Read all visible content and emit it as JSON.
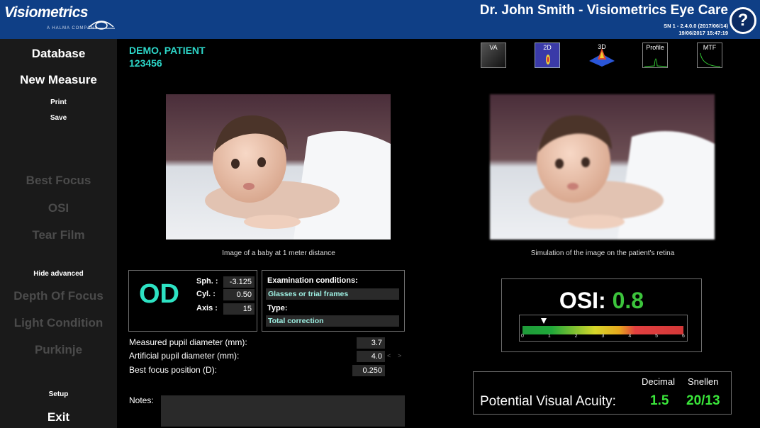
{
  "header": {
    "logo_text": "Visiometrics",
    "logo_sub": "A HALMA COMPANY",
    "title": "Dr. John Smith - Visiometrics Eye Care",
    "serial": "SN 1 - 2.4.0.0 (2017/06/14)",
    "datetime": "19/06/2017 15:47:19",
    "help_label": "?"
  },
  "sidebar": {
    "database": "Database",
    "new_measure": "New Measure",
    "print": "Print",
    "save": "Save",
    "best_focus": "Best Focus",
    "osi": "OSI",
    "tear_film": "Tear Film",
    "hide_advanced": "Hide advanced",
    "depth_of_focus": "Depth Of Focus",
    "light_condition": "Light Condition",
    "purkinje": "Purkinje",
    "setup": "Setup",
    "exit": "Exit"
  },
  "patient": {
    "name": "DEMO, PATIENT",
    "id": "123456"
  },
  "toolbar": {
    "va": "VA",
    "two_d": "2D",
    "three_d": "3D",
    "profile": "Profile",
    "mtf": "MTF"
  },
  "captions": {
    "left": "Image of a baby at 1 meter distance",
    "right": "Simulation of the image on the patient's retina"
  },
  "refraction": {
    "eye": "OD",
    "sph_label": "Sph. :",
    "sph": "-3.125",
    "cyl_label": "Cyl. :",
    "cyl": "0.50",
    "axis_label": "Axis :",
    "axis": "15"
  },
  "exam": {
    "conditions_label": "Examination conditions:",
    "conditions": "Glasses or trial frames",
    "type_label": "Type:",
    "type": "Total correction"
  },
  "measurements": {
    "pupil_label": "Measured pupil diameter (mm):",
    "pupil": "3.7",
    "artificial_label": "Artificial pupil diameter (mm):",
    "artificial": "4.0",
    "focus_label": "Best focus position (D):",
    "focus": "0.250",
    "dec_arrow": "<",
    "inc_arrow": ">"
  },
  "notes": {
    "label": "Notes:",
    "value": ""
  },
  "osi": {
    "label": "OSI:",
    "value": "0.8",
    "value_num": 0.8,
    "scale_min": 0,
    "scale_max": 6,
    "ticks": [
      "0",
      "1",
      "2",
      "3",
      "4",
      "5",
      "6"
    ]
  },
  "visual_acuity": {
    "label": "Potential Visual Acuity:",
    "decimal_header": "Decimal",
    "snellen_header": "Snellen",
    "decimal": "1.5",
    "snellen": "20/13"
  },
  "colors": {
    "header_bg": "#0f3f86",
    "accent_teal": "#2dd6c8",
    "osi_green": "#3cc43c",
    "va_green": "#3ae63a"
  }
}
